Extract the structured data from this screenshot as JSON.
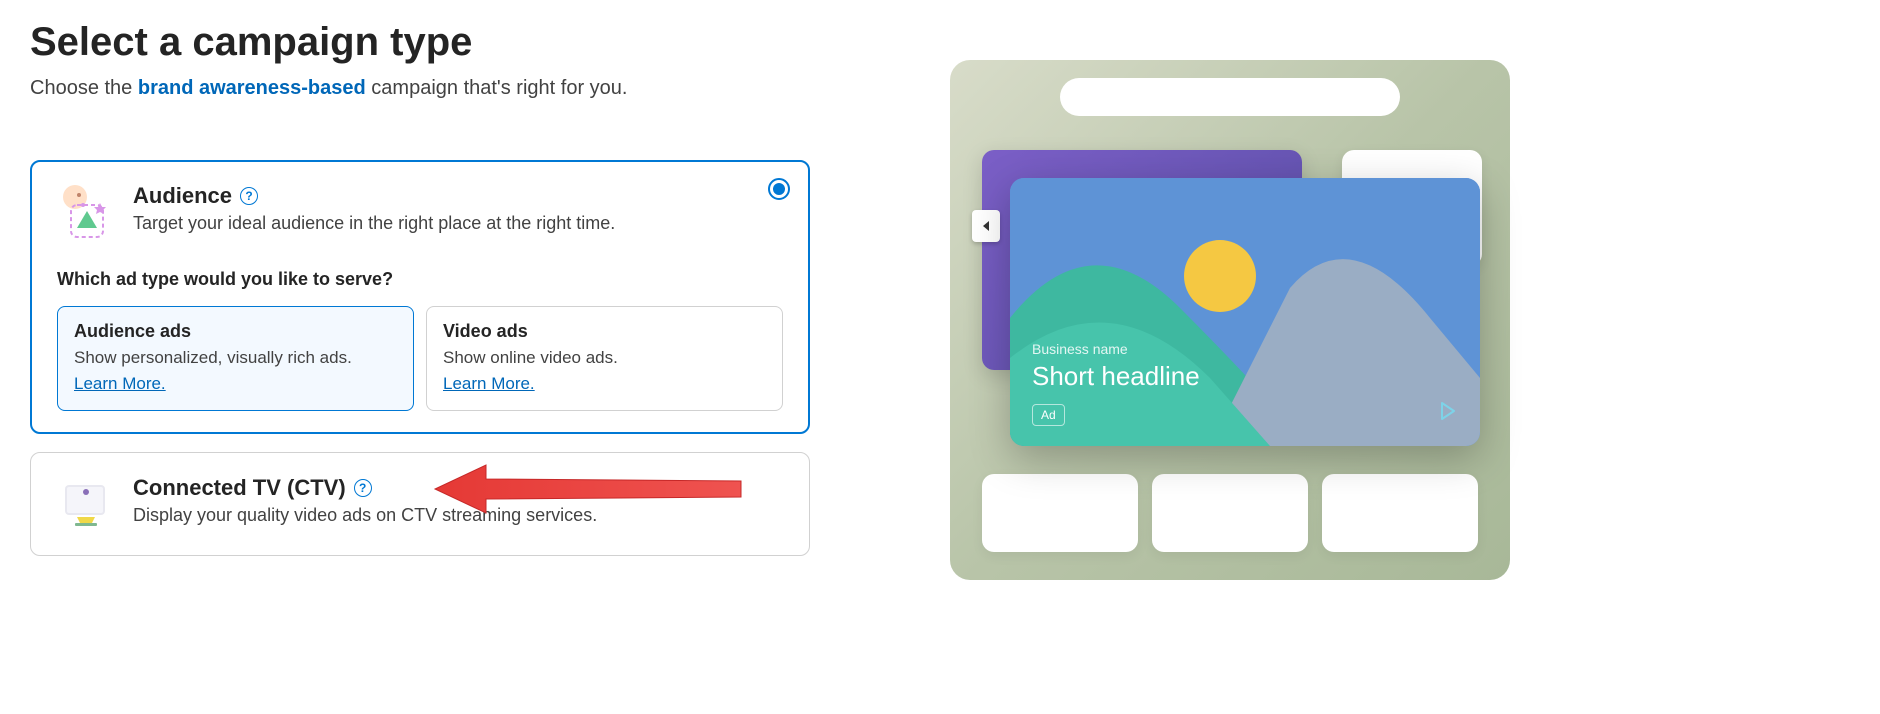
{
  "header": {
    "title": "Select a campaign type",
    "subtitle_pre": "Choose the ",
    "subtitle_highlight": "brand awareness-based",
    "subtitle_post": " campaign that's right for you."
  },
  "options": {
    "audience": {
      "title": "Audience",
      "desc": "Target your ideal audience in the right place at the right time.",
      "selected": true,
      "question": "Which ad type would you like to serve?",
      "types": [
        {
          "title": "Audience ads",
          "desc": "Show personalized, visually rich ads.",
          "learn": "Learn More.",
          "selected": true
        },
        {
          "title": "Video ads",
          "desc": "Show online video ads.",
          "learn": "Learn More.",
          "selected": false
        }
      ]
    },
    "ctv": {
      "title": "Connected TV (CTV)",
      "desc": "Display your quality video ads on CTV streaming services.",
      "selected": false
    }
  },
  "preview": {
    "business": "Business name",
    "headline": "Short headline",
    "badge": "Ad"
  }
}
